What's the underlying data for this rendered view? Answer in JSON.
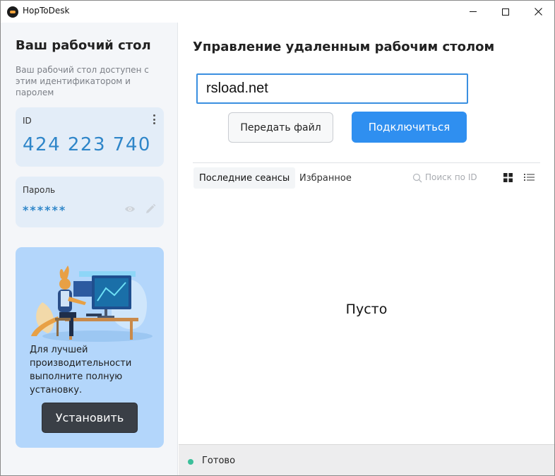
{
  "window": {
    "title": "HopToDesk",
    "minimize_icon": "minimize-icon",
    "maximize_icon": "maximize-icon",
    "close_icon": "close-icon"
  },
  "left": {
    "title": "Ваш рабочий стол",
    "description": "Ваш рабочий стол доступен с этим идентификатором и паролем",
    "id_card": {
      "label": "ID",
      "value": "424 223 740",
      "menu_icon": "kebab-menu-icon"
    },
    "password_card": {
      "label": "Пароль",
      "value": "******",
      "show_icon": "eye-icon",
      "edit_icon": "pencil-icon"
    },
    "promo": {
      "text": "Для лучшей производительности выполните полную установку.",
      "button_label": "Установить"
    }
  },
  "right": {
    "title": "Управление удаленным рабочим столом",
    "remote_id_input": {
      "value": "rsload.net",
      "placeholder": ""
    },
    "send_file_label": "Передать файл",
    "connect_label": "Подключиться",
    "tabs": [
      {
        "label": "Последние сеансы",
        "active": true
      },
      {
        "label": "Избранное",
        "active": false
      }
    ],
    "search": {
      "placeholder": "Поиск по ID"
    },
    "view_icons": [
      "grid-view-icon",
      "list-view-icon"
    ],
    "empty_text": "Пусто"
  },
  "status": {
    "text": "Готово",
    "color": "#3bbf9a"
  },
  "colors": {
    "accent": "#2f8ff0",
    "id_text": "#2f86c9",
    "left_bg": "#f4f6f9",
    "promo_bg": "#b3d6fb"
  }
}
